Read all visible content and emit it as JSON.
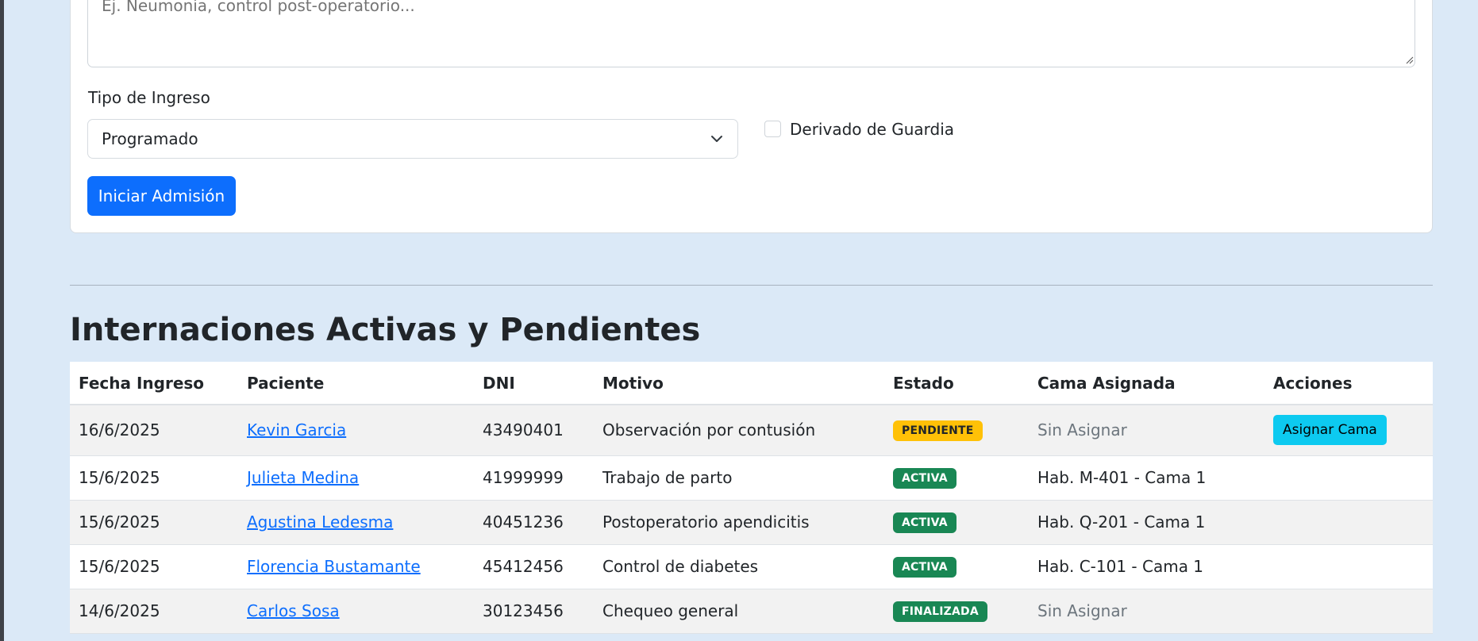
{
  "form": {
    "reason_placeholder": "Ej. Neumonía, control post-operatorio...",
    "tipo_label": "Tipo de Ingreso",
    "tipo_value": "Programado",
    "derivado_label": "Derivado de Guardia",
    "derivado_checked": false,
    "submit_label": "Iniciar Admisión"
  },
  "section_title": "Internaciones Activas y Pendientes",
  "table": {
    "headers": [
      "Fecha Ingreso",
      "Paciente",
      "DNI",
      "Motivo",
      "Estado",
      "Cama Asignada",
      "Acciones"
    ],
    "rows": [
      {
        "fecha": "16/6/2025",
        "paciente": "Kevin Garcia",
        "dni": "43490401",
        "motivo": "Observación por contusión",
        "estado": "PENDIENTE",
        "cama": "Sin Asignar",
        "accion": "Asignar Cama"
      },
      {
        "fecha": "15/6/2025",
        "paciente": "Julieta Medina",
        "dni": "41999999",
        "motivo": "Trabajo de parto",
        "estado": "ACTIVA",
        "cama": "Hab. M-401 - Cama 1",
        "accion": ""
      },
      {
        "fecha": "15/6/2025",
        "paciente": "Agustina Ledesma",
        "dni": "40451236",
        "motivo": "Postoperatorio apendicitis",
        "estado": "ACTIVA",
        "cama": "Hab. Q-201 - Cama 1",
        "accion": ""
      },
      {
        "fecha": "15/6/2025",
        "paciente": "Florencia Bustamante",
        "dni": "45412456",
        "motivo": "Control de diabetes",
        "estado": "ACTIVA",
        "cama": "Hab. C-101 - Cama 1",
        "accion": ""
      },
      {
        "fecha": "14/6/2025",
        "paciente": "Carlos Sosa",
        "dni": "30123456",
        "motivo": "Chequeo general",
        "estado": "FINALIZADA",
        "cama": "Sin Asignar",
        "accion": ""
      }
    ]
  },
  "colors": {
    "page_bg": "#dbe9f7",
    "primary": "#0d6efd",
    "warning": "#ffc107",
    "success": "#198754",
    "info": "#0dcaf0"
  }
}
